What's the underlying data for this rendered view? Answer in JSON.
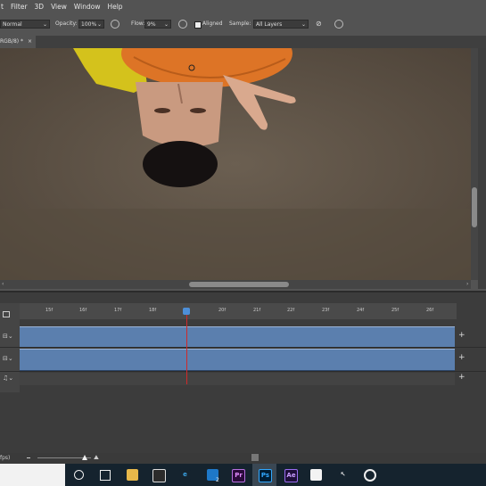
{
  "menubar": {
    "items": [
      "t",
      "Filter",
      "3D",
      "View",
      "Window",
      "Help"
    ]
  },
  "options": {
    "mode": "Normal",
    "opacity_label": "Opacity:",
    "opacity_value": "100%",
    "flow_label": "Flow:",
    "flow_value": "9%",
    "aligned_label": "Aligned",
    "aligned_checked": true,
    "sample_label": "Sample:",
    "sample_value": "All Layers"
  },
  "document": {
    "tab_label": "RGB/8) *",
    "close_glyph": "×"
  },
  "timeline": {
    "ticks": [
      "15f",
      "16f",
      "17f",
      "18f",
      "",
      "20f",
      "21f",
      "22f",
      "23f",
      "24f",
      "25f",
      "26f"
    ],
    "add_glyph": "+",
    "footer_fps": "fps)"
  },
  "taskbar": {
    "mail_badge": "2",
    "app_labels": [
      "Pr",
      "Ps",
      "Ae"
    ]
  },
  "colors": {
    "clip": "#5b7fae",
    "playhead": "#cf2a2a",
    "accent": "#4d8fd8"
  }
}
